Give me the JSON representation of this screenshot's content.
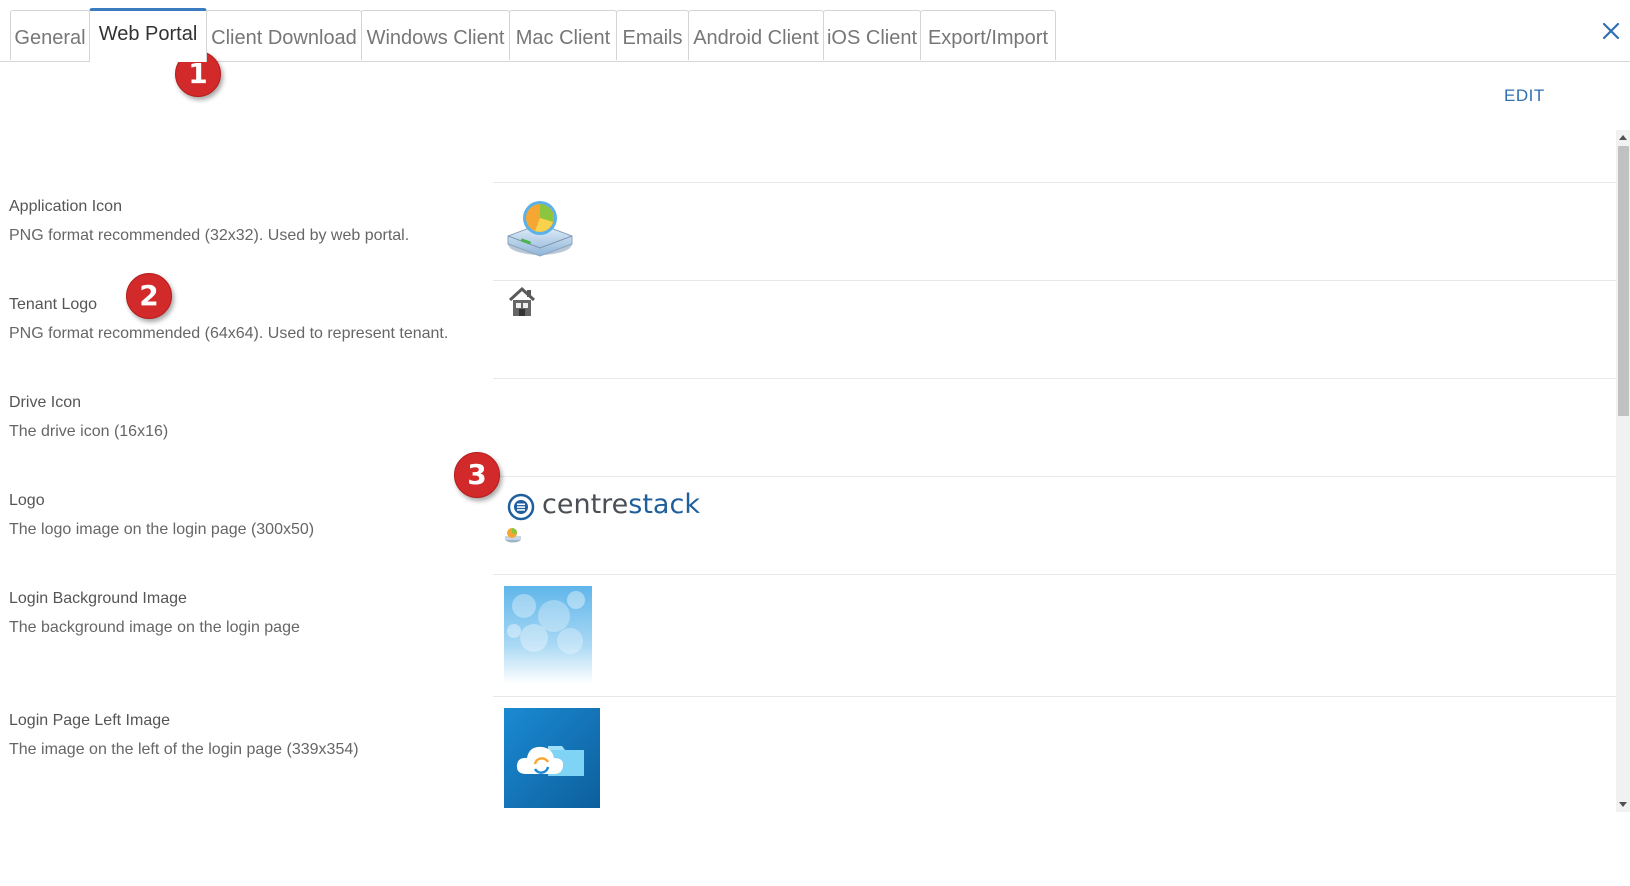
{
  "tabs": [
    {
      "label": "General"
    },
    {
      "label": "Web Portal"
    },
    {
      "label": "Client Download"
    },
    {
      "label": "Windows Client"
    },
    {
      "label": "Mac Client"
    },
    {
      "label": "Emails"
    },
    {
      "label": "Android Client"
    },
    {
      "label": "iOS Client"
    },
    {
      "label": "Export/Import"
    }
  ],
  "active_tab": "Web Portal",
  "header": {
    "edit_label": "EDIT",
    "close_icon": "close-icon"
  },
  "badges": [
    "1",
    "2",
    "3"
  ],
  "settings": [
    {
      "label": "Application Icon",
      "description": "PNG format recommended (32x32). Used by web portal.",
      "icon": "drive-pie-icon"
    },
    {
      "label": "Tenant Logo",
      "description": "PNG format recommended (64x64). Used to represent tenant.",
      "icon": "house-icon"
    },
    {
      "label": "Drive Icon",
      "description": "The drive icon (16x16)",
      "icon": "small-drive-icon"
    },
    {
      "label": "Logo",
      "description": "The logo image on the login page (300x50)",
      "logo_text_a": "centre",
      "logo_text_b": "stack"
    },
    {
      "label": "Login Background Image",
      "description": "The background image on the login page",
      "icon": "bokeh-background-image"
    },
    {
      "label": "Login Page Left Image",
      "description": "The image on the left of the login page (339x354)",
      "icon": "cloud-folder-image"
    }
  ],
  "colors": {
    "accent": "#3a7bbf",
    "link": "#2f6fb3",
    "badge": "#d22a2a",
    "logo_dark": "#4a4f55",
    "logo_blue": "#1f5f9e"
  }
}
